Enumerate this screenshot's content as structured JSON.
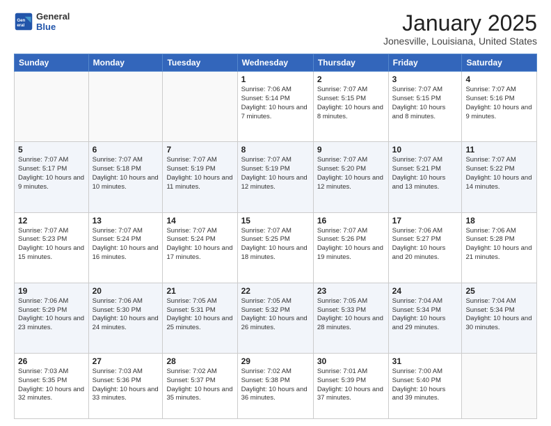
{
  "header": {
    "logo_general": "General",
    "logo_blue": "Blue",
    "month_title": "January 2025",
    "location": "Jonesville, Louisiana, United States"
  },
  "weekdays": [
    "Sunday",
    "Monday",
    "Tuesday",
    "Wednesday",
    "Thursday",
    "Friday",
    "Saturday"
  ],
  "weeks": [
    [
      {
        "day": "",
        "sunrise": "",
        "sunset": "",
        "daylight": ""
      },
      {
        "day": "",
        "sunrise": "",
        "sunset": "",
        "daylight": ""
      },
      {
        "day": "",
        "sunrise": "",
        "sunset": "",
        "daylight": ""
      },
      {
        "day": "1",
        "sunrise": "Sunrise: 7:06 AM",
        "sunset": "Sunset: 5:14 PM",
        "daylight": "Daylight: 10 hours and 7 minutes."
      },
      {
        "day": "2",
        "sunrise": "Sunrise: 7:07 AM",
        "sunset": "Sunset: 5:15 PM",
        "daylight": "Daylight: 10 hours and 8 minutes."
      },
      {
        "day": "3",
        "sunrise": "Sunrise: 7:07 AM",
        "sunset": "Sunset: 5:15 PM",
        "daylight": "Daylight: 10 hours and 8 minutes."
      },
      {
        "day": "4",
        "sunrise": "Sunrise: 7:07 AM",
        "sunset": "Sunset: 5:16 PM",
        "daylight": "Daylight: 10 hours and 9 minutes."
      }
    ],
    [
      {
        "day": "5",
        "sunrise": "Sunrise: 7:07 AM",
        "sunset": "Sunset: 5:17 PM",
        "daylight": "Daylight: 10 hours and 9 minutes."
      },
      {
        "day": "6",
        "sunrise": "Sunrise: 7:07 AM",
        "sunset": "Sunset: 5:18 PM",
        "daylight": "Daylight: 10 hours and 10 minutes."
      },
      {
        "day": "7",
        "sunrise": "Sunrise: 7:07 AM",
        "sunset": "Sunset: 5:19 PM",
        "daylight": "Daylight: 10 hours and 11 minutes."
      },
      {
        "day": "8",
        "sunrise": "Sunrise: 7:07 AM",
        "sunset": "Sunset: 5:19 PM",
        "daylight": "Daylight: 10 hours and 12 minutes."
      },
      {
        "day": "9",
        "sunrise": "Sunrise: 7:07 AM",
        "sunset": "Sunset: 5:20 PM",
        "daylight": "Daylight: 10 hours and 12 minutes."
      },
      {
        "day": "10",
        "sunrise": "Sunrise: 7:07 AM",
        "sunset": "Sunset: 5:21 PM",
        "daylight": "Daylight: 10 hours and 13 minutes."
      },
      {
        "day": "11",
        "sunrise": "Sunrise: 7:07 AM",
        "sunset": "Sunset: 5:22 PM",
        "daylight": "Daylight: 10 hours and 14 minutes."
      }
    ],
    [
      {
        "day": "12",
        "sunrise": "Sunrise: 7:07 AM",
        "sunset": "Sunset: 5:23 PM",
        "daylight": "Daylight: 10 hours and 15 minutes."
      },
      {
        "day": "13",
        "sunrise": "Sunrise: 7:07 AM",
        "sunset": "Sunset: 5:24 PM",
        "daylight": "Daylight: 10 hours and 16 minutes."
      },
      {
        "day": "14",
        "sunrise": "Sunrise: 7:07 AM",
        "sunset": "Sunset: 5:24 PM",
        "daylight": "Daylight: 10 hours and 17 minutes."
      },
      {
        "day": "15",
        "sunrise": "Sunrise: 7:07 AM",
        "sunset": "Sunset: 5:25 PM",
        "daylight": "Daylight: 10 hours and 18 minutes."
      },
      {
        "day": "16",
        "sunrise": "Sunrise: 7:07 AM",
        "sunset": "Sunset: 5:26 PM",
        "daylight": "Daylight: 10 hours and 19 minutes."
      },
      {
        "day": "17",
        "sunrise": "Sunrise: 7:06 AM",
        "sunset": "Sunset: 5:27 PM",
        "daylight": "Daylight: 10 hours and 20 minutes."
      },
      {
        "day": "18",
        "sunrise": "Sunrise: 7:06 AM",
        "sunset": "Sunset: 5:28 PM",
        "daylight": "Daylight: 10 hours and 21 minutes."
      }
    ],
    [
      {
        "day": "19",
        "sunrise": "Sunrise: 7:06 AM",
        "sunset": "Sunset: 5:29 PM",
        "daylight": "Daylight: 10 hours and 23 minutes."
      },
      {
        "day": "20",
        "sunrise": "Sunrise: 7:06 AM",
        "sunset": "Sunset: 5:30 PM",
        "daylight": "Daylight: 10 hours and 24 minutes."
      },
      {
        "day": "21",
        "sunrise": "Sunrise: 7:05 AM",
        "sunset": "Sunset: 5:31 PM",
        "daylight": "Daylight: 10 hours and 25 minutes."
      },
      {
        "day": "22",
        "sunrise": "Sunrise: 7:05 AM",
        "sunset": "Sunset: 5:32 PM",
        "daylight": "Daylight: 10 hours and 26 minutes."
      },
      {
        "day": "23",
        "sunrise": "Sunrise: 7:05 AM",
        "sunset": "Sunset: 5:33 PM",
        "daylight": "Daylight: 10 hours and 28 minutes."
      },
      {
        "day": "24",
        "sunrise": "Sunrise: 7:04 AM",
        "sunset": "Sunset: 5:34 PM",
        "daylight": "Daylight: 10 hours and 29 minutes."
      },
      {
        "day": "25",
        "sunrise": "Sunrise: 7:04 AM",
        "sunset": "Sunset: 5:34 PM",
        "daylight": "Daylight: 10 hours and 30 minutes."
      }
    ],
    [
      {
        "day": "26",
        "sunrise": "Sunrise: 7:03 AM",
        "sunset": "Sunset: 5:35 PM",
        "daylight": "Daylight: 10 hours and 32 minutes."
      },
      {
        "day": "27",
        "sunrise": "Sunrise: 7:03 AM",
        "sunset": "Sunset: 5:36 PM",
        "daylight": "Daylight: 10 hours and 33 minutes."
      },
      {
        "day": "28",
        "sunrise": "Sunrise: 7:02 AM",
        "sunset": "Sunset: 5:37 PM",
        "daylight": "Daylight: 10 hours and 35 minutes."
      },
      {
        "day": "29",
        "sunrise": "Sunrise: 7:02 AM",
        "sunset": "Sunset: 5:38 PM",
        "daylight": "Daylight: 10 hours and 36 minutes."
      },
      {
        "day": "30",
        "sunrise": "Sunrise: 7:01 AM",
        "sunset": "Sunset: 5:39 PM",
        "daylight": "Daylight: 10 hours and 37 minutes."
      },
      {
        "day": "31",
        "sunrise": "Sunrise: 7:00 AM",
        "sunset": "Sunset: 5:40 PM",
        "daylight": "Daylight: 10 hours and 39 minutes."
      },
      {
        "day": "",
        "sunrise": "",
        "sunset": "",
        "daylight": ""
      }
    ]
  ]
}
